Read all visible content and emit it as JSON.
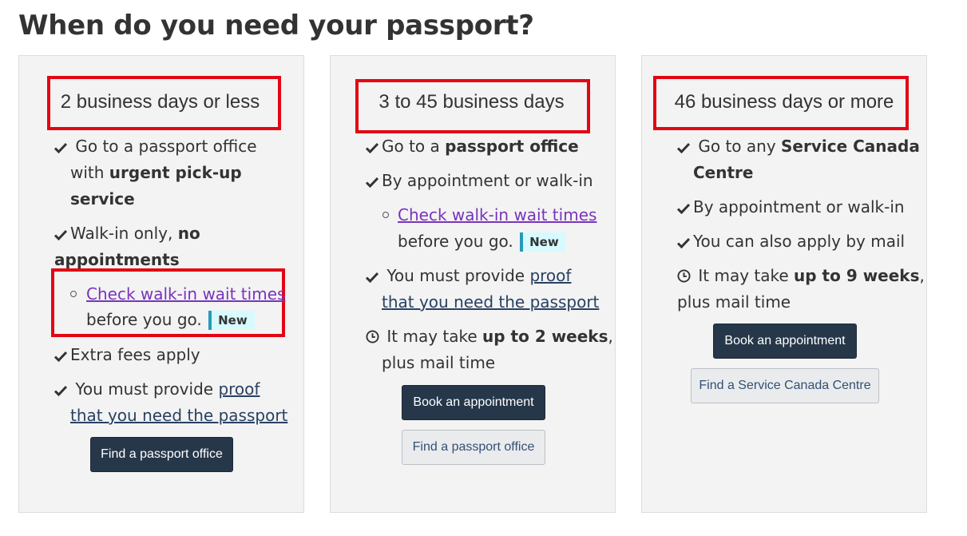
{
  "page": {
    "heading": "When do you need your passport?"
  },
  "badge_label": "New",
  "cards": [
    {
      "title": "2 business days or less",
      "items": {
        "item1_a": "Go to a passport office",
        "item1_b": "with ",
        "item1_b_bold": "urgent pick-up",
        "item1_c_bold": "service",
        "item2_a": "Walk-in only, ",
        "item2_a_bold": "no",
        "item2_b_bold": "appointments",
        "link_wait": "Check walk-in wait times",
        "before_go": "before you go.",
        "item3": "Extra fees apply",
        "item4_a": "You must provide ",
        "item4_a_link": "proof",
        "item4_b_link": "that you need the passport"
      },
      "button": "Find a passport office"
    },
    {
      "title": "3 to 45 business days",
      "items": {
        "item1_a": "Go to a ",
        "item1_a_bold": "passport office",
        "item2": "By appointment or walk-in",
        "link_wait": "Check walk-in wait times",
        "before_go": "before you go.",
        "item3_a": "You must provide ",
        "item3_a_link": "proof",
        "item3_b_link": "that you need the passport",
        "item4_a": "It may take ",
        "item4_a_bold": "up to 2 weeks",
        "item4_a_end": ",",
        "item4_b": "plus mail time"
      },
      "button_primary": "Book an appointment",
      "button_secondary": "Find a passport office"
    },
    {
      "title": "46 business days or more",
      "items": {
        "item1_a": "Go to any ",
        "item1_a_bold": "Service Canada",
        "item1_b_bold": "Centre",
        "item2": "By appointment or walk-in",
        "item3": "You can also apply by mail",
        "item4_a": "It may take ",
        "item4_a_bold": "up to 9 weeks",
        "item4_a_end": ",",
        "item4_b": "plus mail time"
      },
      "button_primary": "Book an appointment",
      "button_secondary": "Find a Service Canada Centre"
    }
  ],
  "icons": {
    "check": "checkmark-icon",
    "clock": "clock-icon"
  },
  "colors": {
    "highlight_box": "#e30613",
    "dark_button": "#26374a",
    "visited_link": "#7834bc",
    "link": "#284162",
    "badge_bg": "#d7faff",
    "badge_border": "#269abc"
  }
}
